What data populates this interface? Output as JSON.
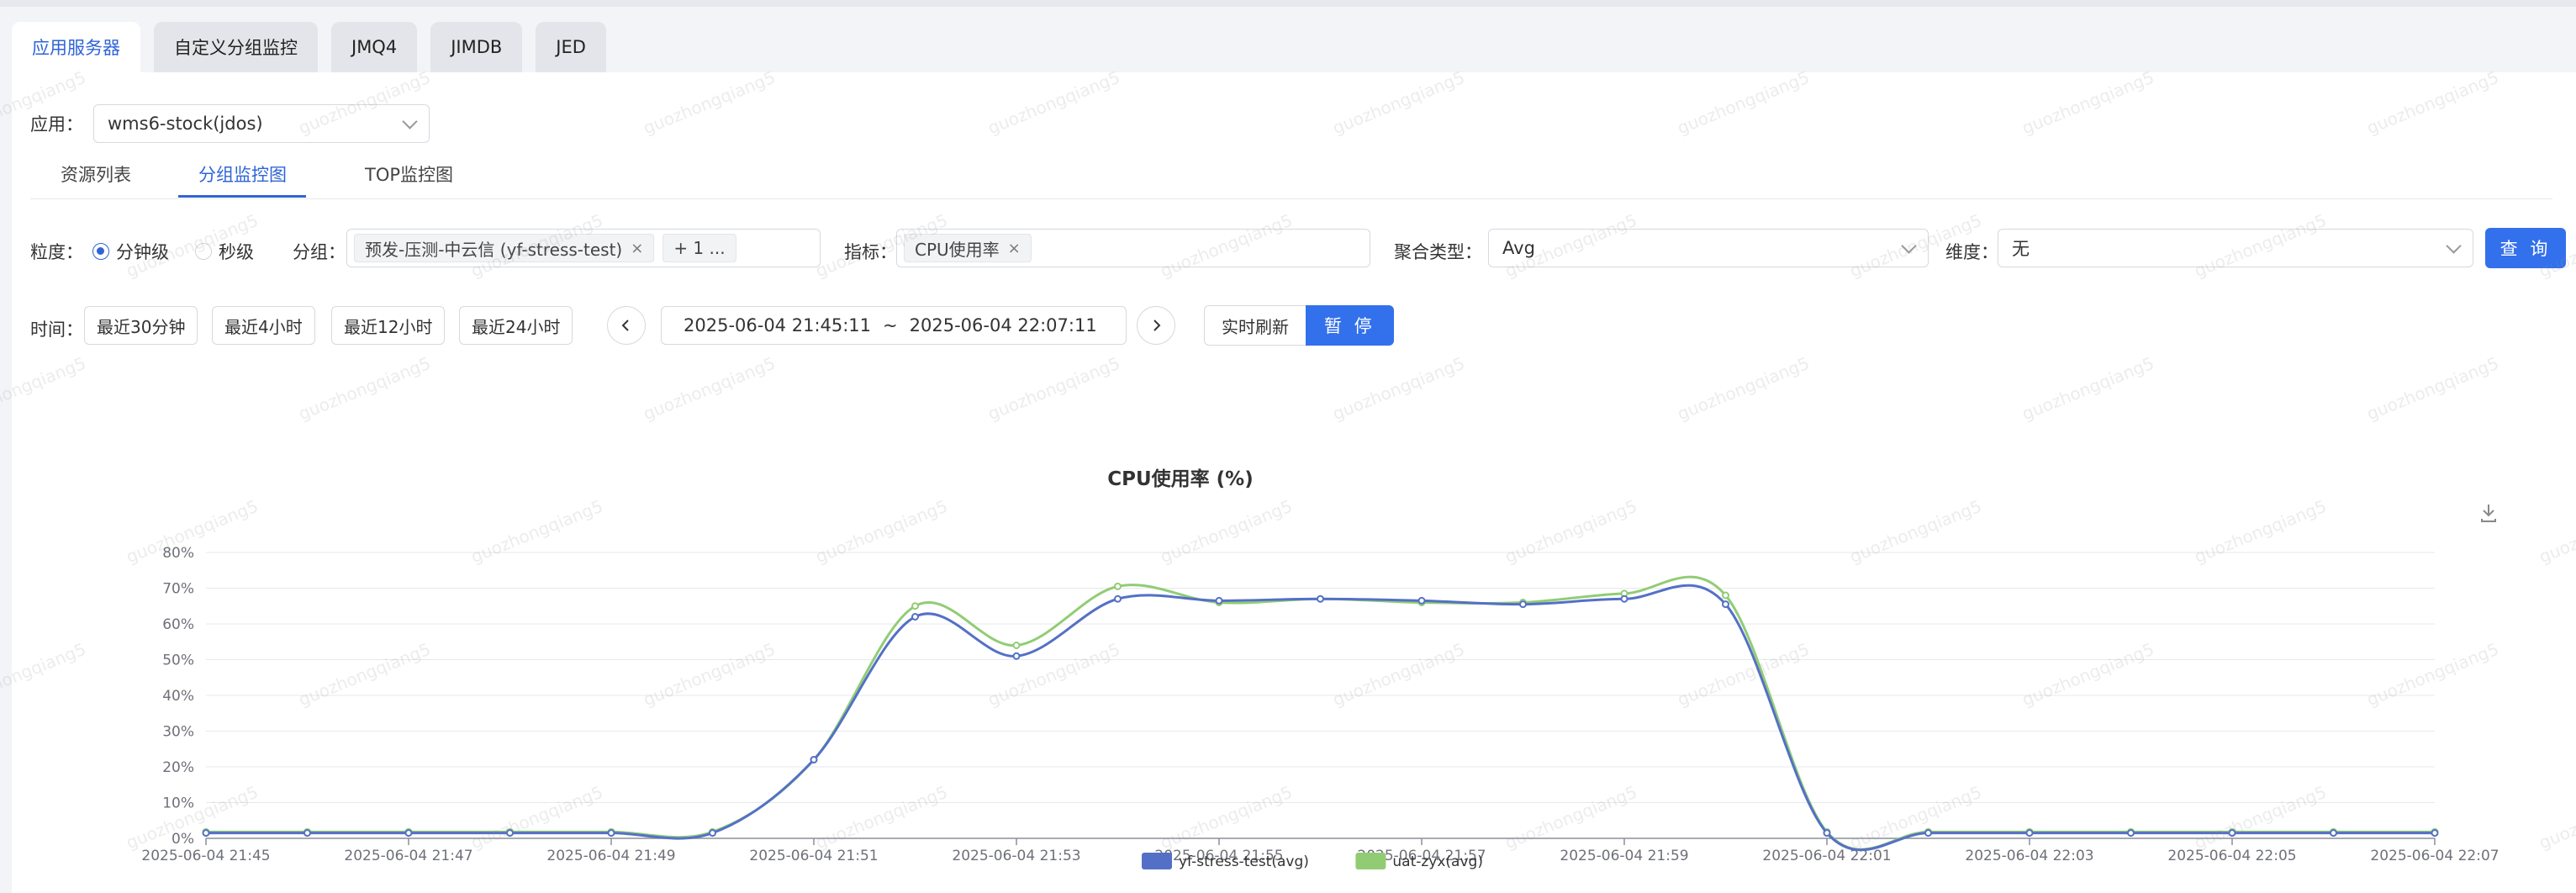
{
  "top_tabs": [
    {
      "label": "应用服务器",
      "active": true
    },
    {
      "label": "自定义分组监控",
      "active": false
    },
    {
      "label": "JMQ4",
      "active": false
    },
    {
      "label": "JIMDB",
      "active": false
    },
    {
      "label": "JED",
      "active": false
    }
  ],
  "app": {
    "label": "应用：",
    "value": "wms6-stock(jdos)"
  },
  "sub_tabs": [
    {
      "label": "资源列表",
      "active": false
    },
    {
      "label": "分组监控图",
      "active": true
    },
    {
      "label": "TOP监控图",
      "active": false
    }
  ],
  "filters": {
    "granularity_label": "粒度：",
    "granularity_options": [
      {
        "label": "分钟级",
        "selected": true
      },
      {
        "label": "秒级",
        "selected": false
      }
    ],
    "group_label": "分组：",
    "group_tag": "预发-压测-中云信 (yf-stress-test)",
    "group_more": "+ 1 ...",
    "metric_label": "指标：",
    "metric_tag": "CPU使用率",
    "agg_label": "聚合类型：",
    "agg_value": "Avg",
    "dim_label": "维度：",
    "dim_value": "无",
    "query_button": "查 询"
  },
  "time": {
    "label": "时间：",
    "quick": [
      "最近30分钟",
      "最近4小时",
      "最近12小时",
      "最近24小时"
    ],
    "start": "2025-06-04 21:45:11",
    "sep": "~",
    "end": "2025-06-04 22:07:11",
    "realtime_label": "实时刷新",
    "pause_label": "暂 停"
  },
  "watermark": "guozhongqiang5",
  "chart_data": {
    "type": "line",
    "title": "CPU使用率 (%)",
    "x": [
      "2025-06-04 21:45",
      "2025-06-04 21:46",
      "2025-06-04 21:47",
      "2025-06-04 21:48",
      "2025-06-04 21:49",
      "2025-06-04 21:50",
      "2025-06-04 21:51",
      "2025-06-04 21:52",
      "2025-06-04 21:53",
      "2025-06-04 21:54",
      "2025-06-04 21:55",
      "2025-06-04 21:56",
      "2025-06-04 21:57",
      "2025-06-04 21:58",
      "2025-06-04 21:59",
      "2025-06-04 22:00",
      "2025-06-04 22:01",
      "2025-06-04 22:02",
      "2025-06-04 22:03",
      "2025-06-04 22:04",
      "2025-06-04 22:05",
      "2025-06-04 22:06",
      "2025-06-04 22:07"
    ],
    "x_tick_labels": [
      "2025-06-04 21:45",
      "2025-06-04 21:47",
      "2025-06-04 21:49",
      "2025-06-04 21:51",
      "2025-06-04 21:53",
      "2025-06-04 21:55",
      "2025-06-04 21:57",
      "2025-06-04 21:59",
      "2025-06-04 22:01",
      "2025-06-04 22:03",
      "2025-06-04 22:05",
      "2025-06-04 22:07"
    ],
    "y_ticks": [
      "0%",
      "10%",
      "20%",
      "30%",
      "40%",
      "50%",
      "60%",
      "70%",
      "80%"
    ],
    "ylim": [
      0,
      80
    ],
    "grid": true,
    "legend_position": "bottom-center",
    "series": [
      {
        "name": "yf-stress-test(avg)",
        "color": "#5470c6",
        "values": [
          1.5,
          1.5,
          1.5,
          1.5,
          1.5,
          1.5,
          22,
          62,
          51,
          67,
          66.5,
          67,
          66.5,
          65.5,
          67,
          65.5,
          1.5,
          1.5,
          1.5,
          1.5,
          1.5,
          1.5,
          1.5
        ]
      },
      {
        "name": "uat-zyx(avg)",
        "color": "#91cc75",
        "values": [
          1.8,
          1.8,
          1.8,
          1.8,
          1.8,
          1.8,
          22,
          65,
          54,
          70.5,
          66,
          67,
          66,
          66,
          68.5,
          68,
          1.8,
          1.8,
          1.8,
          1.8,
          1.8,
          1.8,
          1.8
        ]
      }
    ]
  }
}
